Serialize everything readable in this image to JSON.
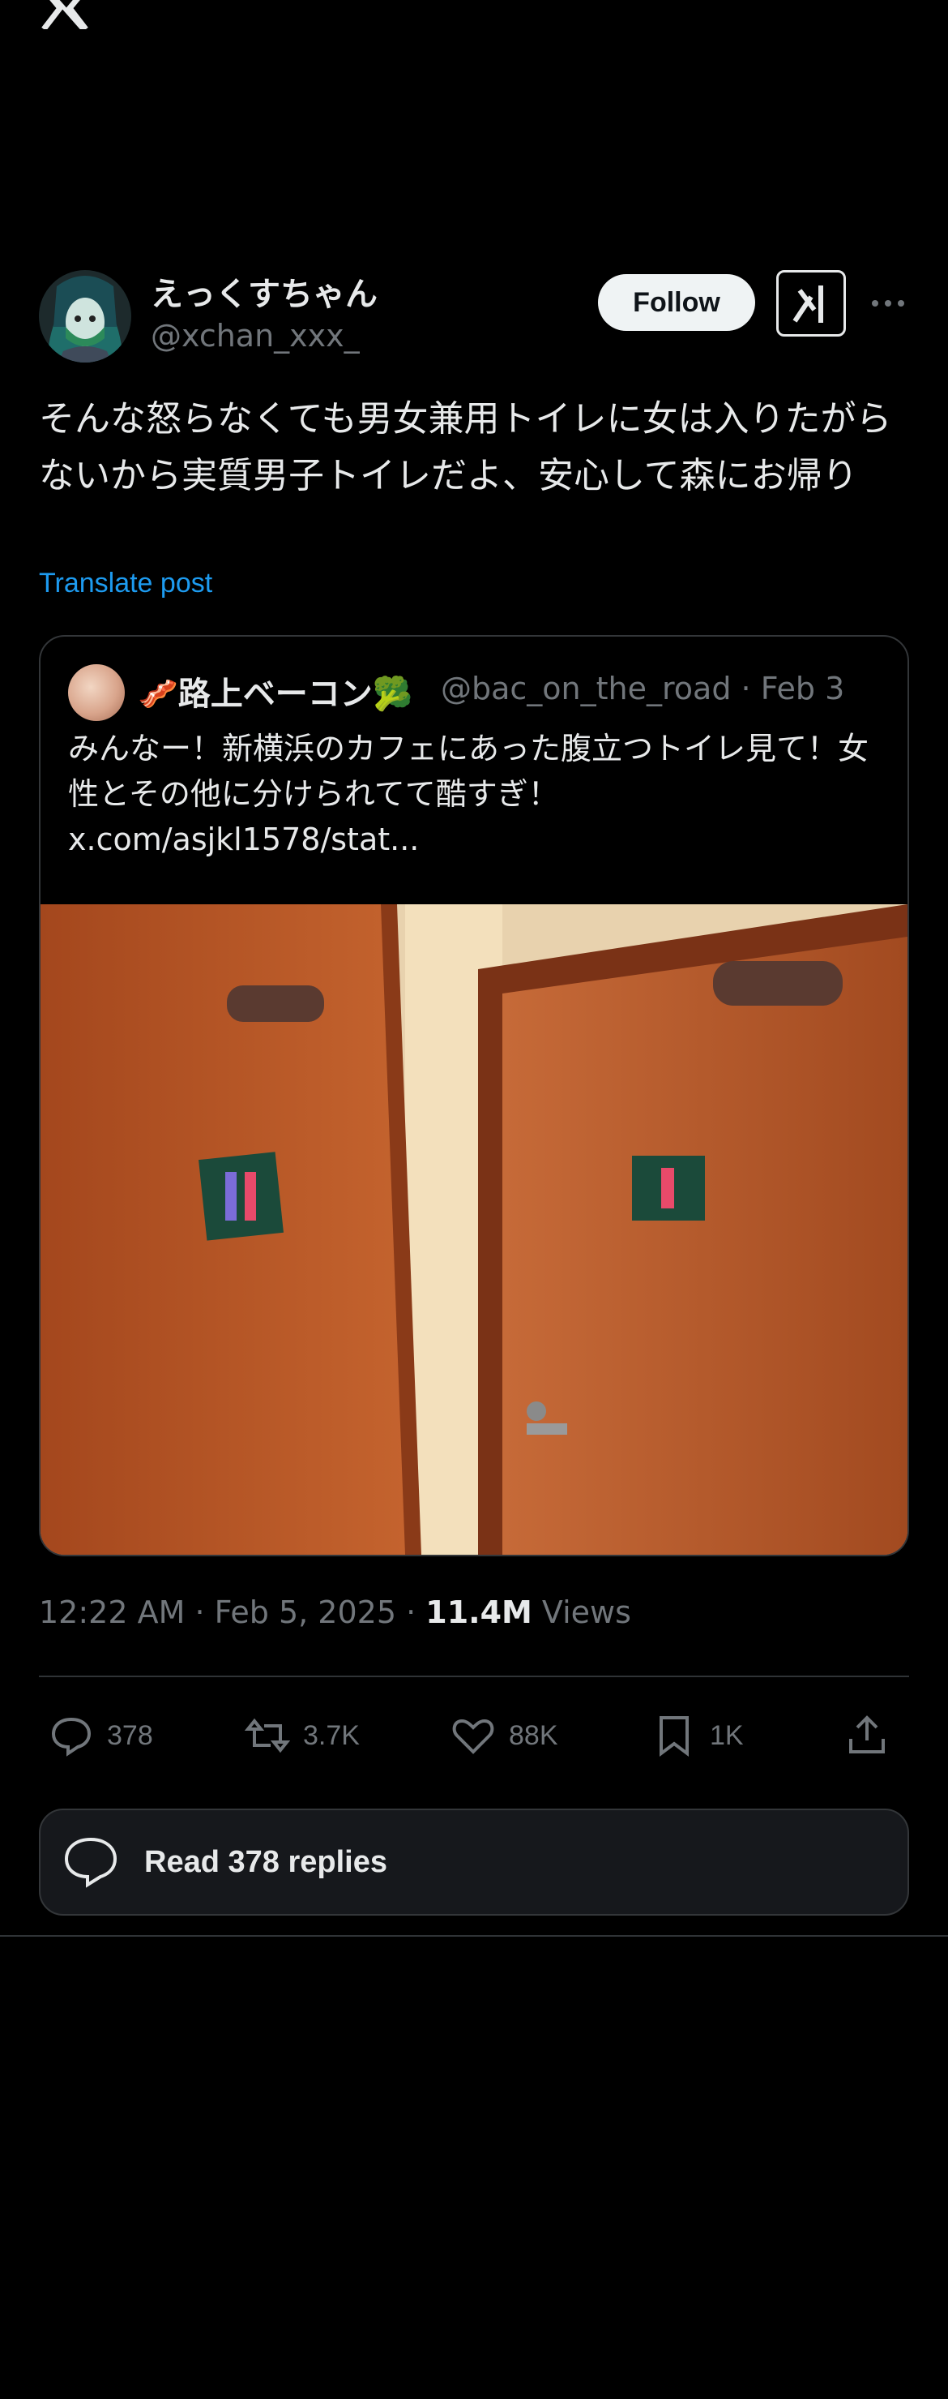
{
  "header": {
    "logo_icon": "x-logo-icon",
    "more_icon": "more-horizontal-icon"
  },
  "author": {
    "display_name": "えっくすちゃん",
    "handle": "@xchan_xxx_",
    "follow_label": "Follow"
  },
  "post": {
    "text": "そんな怒らなくても男女兼用トイレに女は入りたがらないから実質男子トイレだよ、安心して森にお帰り",
    "translate_label": "Translate post"
  },
  "quoted_post": {
    "display_name": "🥓路上ベーコン🥦",
    "handle": "@bac_on_the_road",
    "separator": "·",
    "date": "Feb 3",
    "text": "みんなー！新横浜のカフェにあった腹立つトイレ見て！女性とその他に分けられてて酷すぎ！",
    "link": "x.com/asjkl1578/stat..."
  },
  "meta": {
    "time_date": "12:22 AM · Feb 5, 2025 · ",
    "views_count": "11.4M",
    "views_label": " Views"
  },
  "actions": {
    "replies": "378",
    "reposts": "3.7K",
    "likes": "88K",
    "bookmarks": "1K"
  },
  "read_replies_label": "Read 378 replies",
  "colors": {
    "background": "#000000",
    "primary_text": "#e7e9ea",
    "secondary_text": "#71767b",
    "link": "#1d9bf0",
    "border": "#2f3336"
  }
}
